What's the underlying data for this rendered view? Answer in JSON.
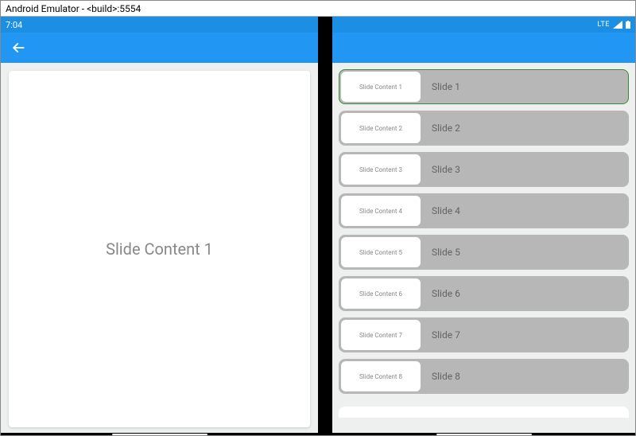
{
  "window_title": "Android Emulator - <build>:5554",
  "statusbar": {
    "time": "7:04",
    "network": "LTE"
  },
  "main_slide": {
    "content": "Slide Content 1"
  },
  "slides": [
    {
      "thumb": "Slide Content 1",
      "label": "Slide 1",
      "selected": true
    },
    {
      "thumb": "Slide Content 2",
      "label": "Slide 2",
      "selected": false
    },
    {
      "thumb": "Slide Content 3",
      "label": "Slide 3",
      "selected": false
    },
    {
      "thumb": "Slide Content 4",
      "label": "Slide 4",
      "selected": false
    },
    {
      "thumb": "Slide Content 5",
      "label": "Slide 5",
      "selected": false
    },
    {
      "thumb": "Slide Content 6",
      "label": "Slide 6",
      "selected": false
    },
    {
      "thumb": "Slide Content 7",
      "label": "Slide 7",
      "selected": false
    },
    {
      "thumb": "Slide Content 8",
      "label": "Slide 8",
      "selected": false
    }
  ]
}
